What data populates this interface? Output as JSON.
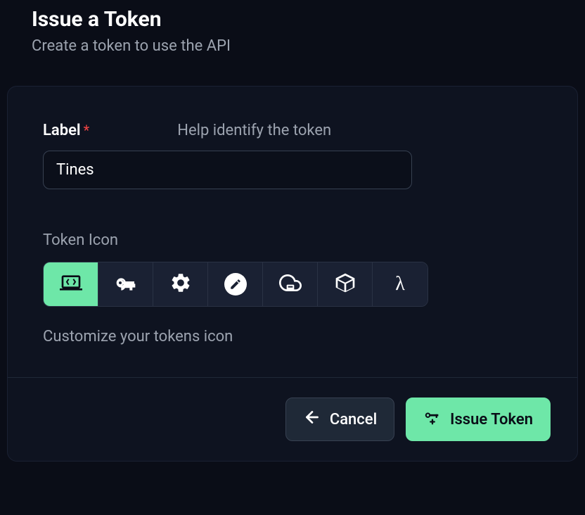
{
  "header": {
    "title": "Issue a Token",
    "subtitle": "Create a token to use the API"
  },
  "form": {
    "label_field": {
      "label": "Label",
      "required": "*",
      "help": "Help identify the token",
      "value": "Tines"
    },
    "icon_section": {
      "label": "Token Icon",
      "help": "Customize your tokens icon",
      "options": [
        {
          "name": "laptop-code",
          "selected": true
        },
        {
          "name": "key",
          "selected": false
        },
        {
          "name": "gear",
          "selected": false
        },
        {
          "name": "pen",
          "selected": false
        },
        {
          "name": "cloud-download",
          "selected": false
        },
        {
          "name": "cube",
          "selected": false
        },
        {
          "name": "lambda",
          "selected": false
        }
      ]
    }
  },
  "footer": {
    "cancel_label": "Cancel",
    "submit_label": "Issue Token"
  },
  "colors": {
    "accent": "#6ee7a8",
    "background": "#0a0d17",
    "card": "#0e1320"
  }
}
